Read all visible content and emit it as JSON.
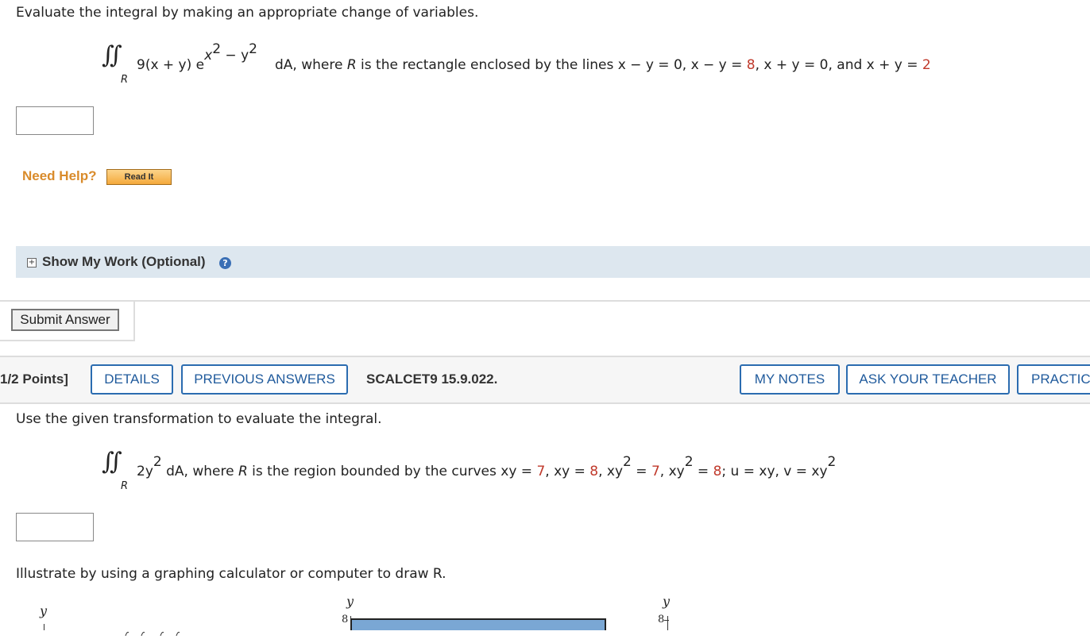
{
  "problem1": {
    "prompt": "Evaluate the integral by making an appropriate change of variables.",
    "integral_symbol": "∬",
    "region_sub": "R",
    "integrand": "9(x + y) e",
    "exponent": "x",
    "exp_sq1": "2",
    "exp_minus": " − y",
    "exp_sq2": "2",
    "text_dA": "dA, where ",
    "text_R": "R",
    "text_rest": " is the rectangle enclosed by the lines ",
    "line1": "x − y = 0, x − y = ",
    "val1": "8",
    "line2": ", x + y = 0, and x + y = ",
    "val2": "2",
    "answer_value": ""
  },
  "need_help": {
    "label": "Need Help?",
    "read_it": "Read It"
  },
  "show_my_work": {
    "label": "Show My Work (Optional)",
    "plus": "+",
    "help": "?"
  },
  "submit": {
    "label": "Submit Answer"
  },
  "problem2_header": {
    "points": "1/2 Points]",
    "details": "DETAILS",
    "previous_answers": "PREVIOUS ANSWERS",
    "code": "SCALCET9 15.9.022.",
    "my_notes": "MY NOTES",
    "ask_teacher": "ASK YOUR TEACHER",
    "practice": "PRACTIC"
  },
  "problem2": {
    "prompt": "Use the given transformation to evaluate the integral.",
    "integral_symbol": "∬",
    "region_sub": "R",
    "integrand": "2y",
    "sq": "2",
    "text_dA": " dA, where ",
    "text_R": "R",
    "text_rest": " is the region bounded by the curves ",
    "c1": "xy = ",
    "v1": "7",
    "c2": ", xy = ",
    "v2": "8",
    "c3": ", xy",
    "c3sq": "2",
    "c3b": " = ",
    "v3": "7",
    "c4": ", xy",
    "c4sq": "2",
    "c4b": " = ",
    "v4": "8",
    "c5": "; u = xy, v = xy",
    "c5sq": "2",
    "answer_value": ""
  },
  "illustrate": {
    "prompt": "Illustrate by using a graphing calculator or computer to draw R.",
    "graph1_ylabel": "y",
    "graph2_ylabel": "y",
    "graph2_tick": "8",
    "graph3_ylabel": "y",
    "graph3_tick": "8"
  },
  "colors": {
    "accent_blue": "#2b6cb0",
    "red_value": "#c0392b",
    "need_help_orange": "#d98b2b",
    "region_fill": "#7aa7d4"
  }
}
